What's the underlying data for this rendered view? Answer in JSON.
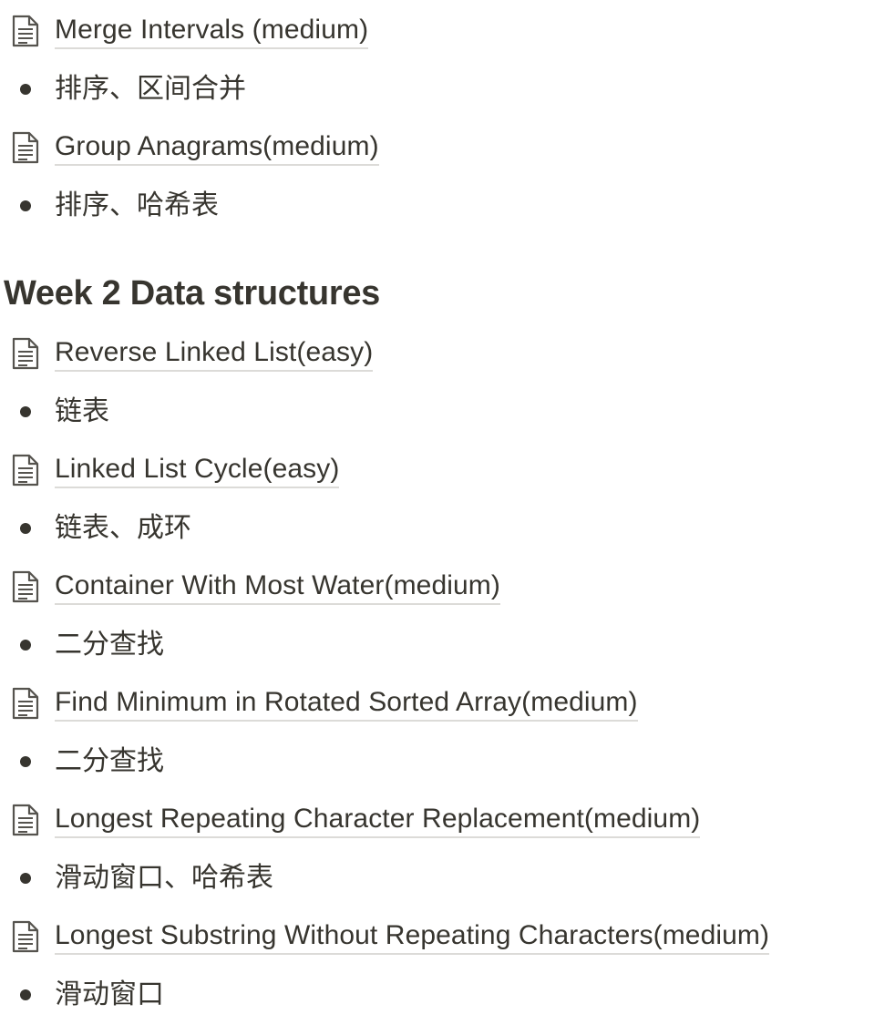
{
  "blocks": [
    {
      "type": "page",
      "title": "Merge Intervals (medium)",
      "icon": "document-icon"
    },
    {
      "type": "bullet",
      "text": "排序、区间合并"
    },
    {
      "type": "page",
      "title": "Group Anagrams(medium)",
      "icon": "document-icon"
    },
    {
      "type": "bullet",
      "text": "排序、哈希表"
    },
    {
      "type": "heading",
      "text": "Week 2 Data structures"
    },
    {
      "type": "page",
      "title": "Reverse Linked List(easy)",
      "icon": "document-icon"
    },
    {
      "type": "bullet",
      "text": "链表"
    },
    {
      "type": "page",
      "title": "Linked List Cycle(easy)",
      "icon": "document-icon"
    },
    {
      "type": "bullet",
      "text": "链表、成环"
    },
    {
      "type": "page",
      "title": "Container With Most Water(medium)",
      "icon": "document-icon"
    },
    {
      "type": "bullet",
      "text": "二分查找"
    },
    {
      "type": "page",
      "title": "Find Minimum in Rotated Sorted Array(medium)",
      "icon": "document-icon"
    },
    {
      "type": "bullet",
      "text": "二分查找"
    },
    {
      "type": "page",
      "title": "Longest Repeating Character Replacement(medium)",
      "icon": "document-icon"
    },
    {
      "type": "bullet",
      "text": "滑动窗口、哈希表"
    },
    {
      "type": "page",
      "title": "Longest Substring Without Repeating Characters(medium)",
      "icon": "document-icon"
    },
    {
      "type": "bullet",
      "text": "滑动窗口"
    }
  ]
}
